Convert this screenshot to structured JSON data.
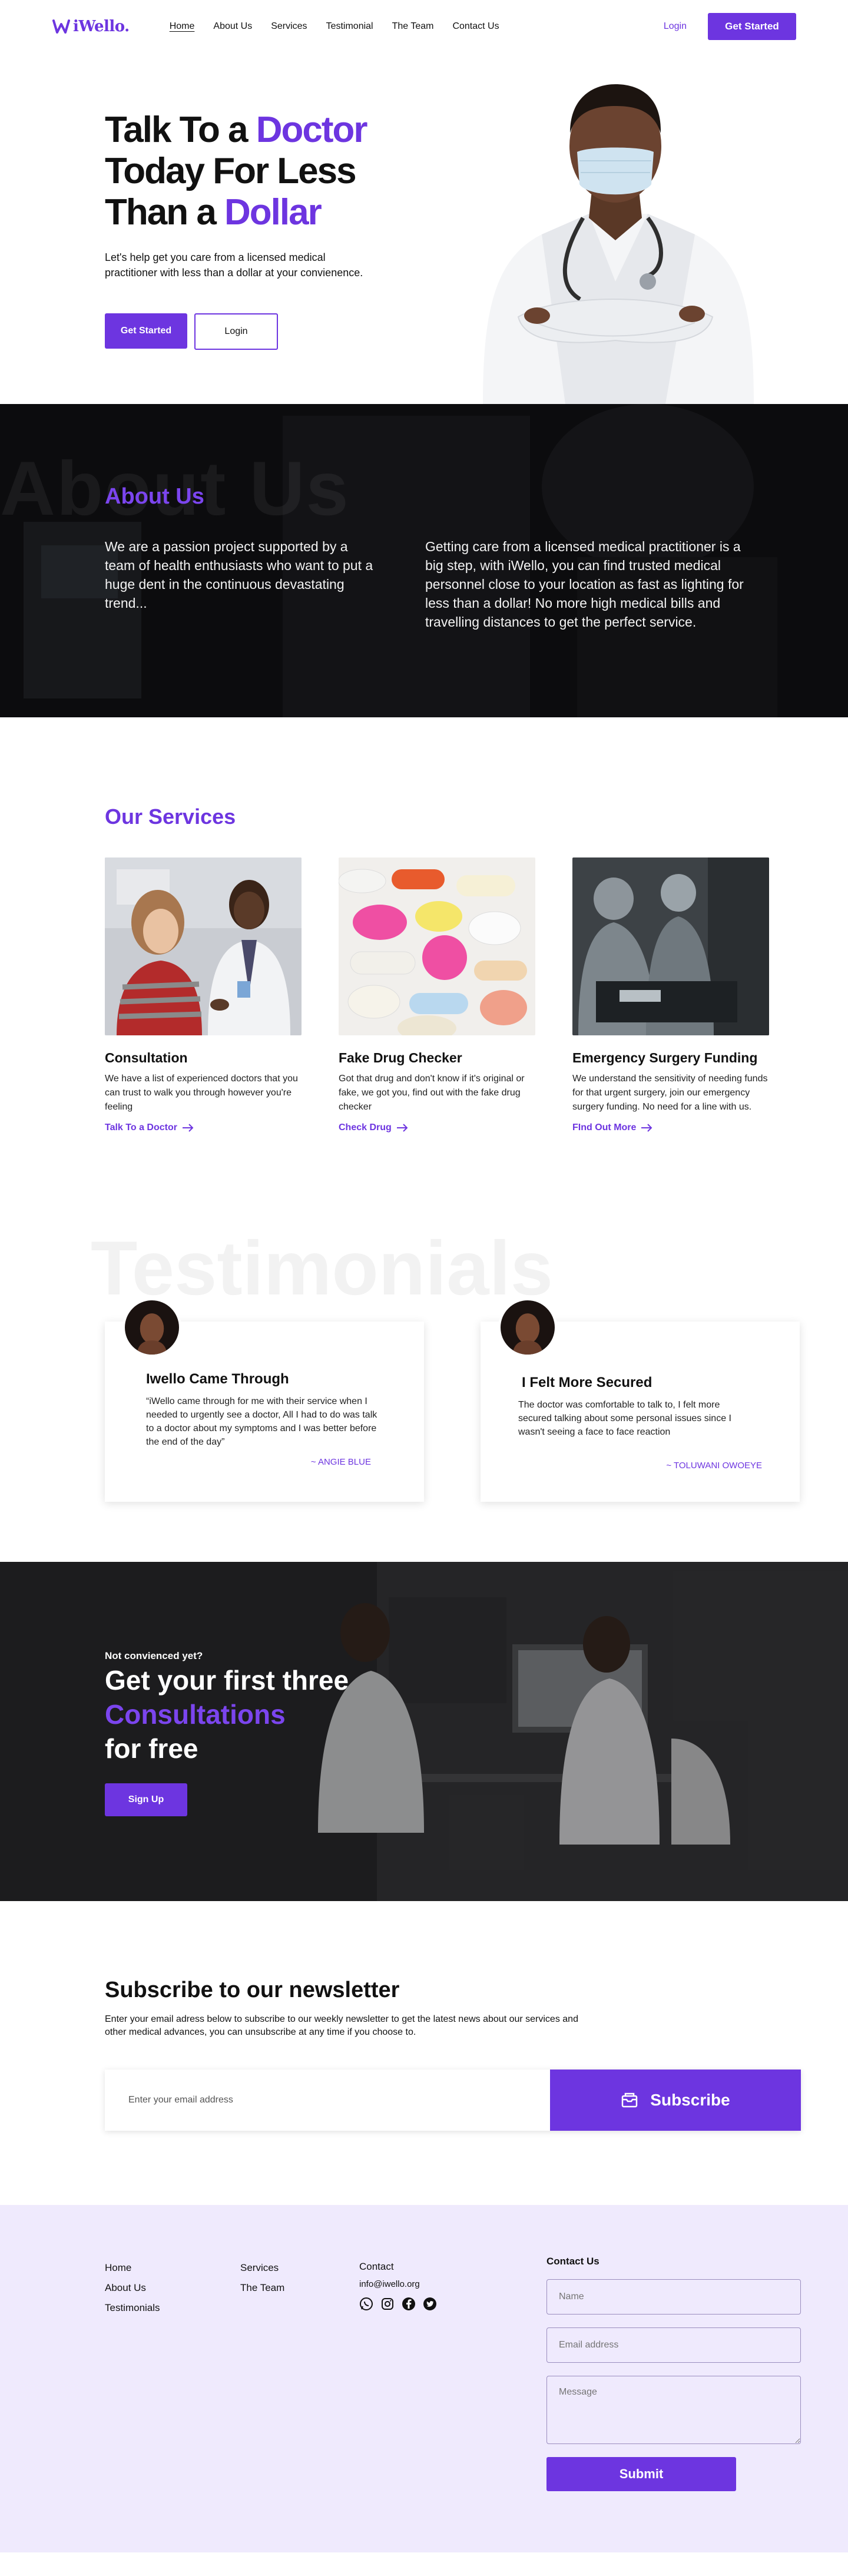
{
  "brand": {
    "name": "iWello.",
    "accent": "#6d35e0"
  },
  "nav": {
    "links": [
      "Home",
      "About Us",
      "Services",
      "Testimonial",
      "The Team",
      "Contact Us"
    ],
    "login": "Login",
    "cta": "Get Started"
  },
  "hero": {
    "t1": "Talk To a ",
    "t1_em": "Doctor",
    "t2": "Today For Less",
    "t3": "Than a ",
    "t3_em": "Dollar",
    "subtitle": "Let's help get you care from a licensed medical practitioner with less than a dollar at your convienence.",
    "cta": "Get Started",
    "login": "Login"
  },
  "about": {
    "ghost": "About Us",
    "title": "About Us",
    "left": "We are a passion project supported by a team of health enthusiasts who want to put a huge dent in the continuous devastating trend...",
    "right": "Getting care from a licensed medical practitioner is a big step, with iWello, you can find trusted medical personnel close to your location as fast as lighting for less than a dollar! No more high medical bills and travelling distances to get the perfect service."
  },
  "services": {
    "title": "Our Services",
    "items": [
      {
        "title": "Consultation",
        "text": "We have a list of experienced doctors that you can trust to walk you through however you're feeling",
        "link": "Talk To a Doctor"
      },
      {
        "title": "Fake Drug Checker",
        "text": "Got that drug and don't know if it's original or fake, we got you, find out with the fake drug checker",
        "link": "Check Drug"
      },
      {
        "title": "Emergency Surgery Funding",
        "text": "We understand the sensitivity of needing funds for that urgent surgery, join our emergency surgery funding. No need for a line with us.",
        "link": "FInd Out More"
      }
    ]
  },
  "testimonials": {
    "ghost": "Testimonials",
    "items": [
      {
        "title": "Iwello Came Through",
        "text": "“iWello came through for me with their service when I needed to urgently see a doctor, All I had to do was talk to a doctor about my symptoms and I was better before the end of the day”",
        "author": "~ ANGIE BLUE"
      },
      {
        "title": "I Felt More Secured",
        "text": "The doctor was comfortable to talk to, I felt more secured talking about some personal issues since I wasn't seeing a face to face reaction",
        "author": "~ TOLUWANI OWOEYE"
      }
    ]
  },
  "promo": {
    "small": "Not convienced yet?",
    "l1": "Get your first three",
    "l2": "Consultations",
    "l3": "for free",
    "cta": "Sign Up"
  },
  "newsletter": {
    "title": "Subscribe to our newsletter",
    "text": "Enter your email adress below to subscribe to our weekly newsletter to get the latest news about our services and other medical advances, you can unsubscribe at any time if you choose to.",
    "placeholder": "Enter your email address",
    "button": "Subscribe"
  },
  "footer": {
    "col1": [
      "Home",
      "About Us",
      "Testimonials"
    ],
    "col2": [
      "Services",
      "The Team"
    ],
    "contact_label": "Contact",
    "email": "info@iwello.org",
    "socials": [
      "whatsapp-icon",
      "instagram-icon",
      "facebook-icon",
      "twitter-icon"
    ],
    "form": {
      "title": "Contact Us",
      "name": "Name",
      "email": "Email address",
      "message": "Message",
      "submit": "Submit"
    }
  }
}
